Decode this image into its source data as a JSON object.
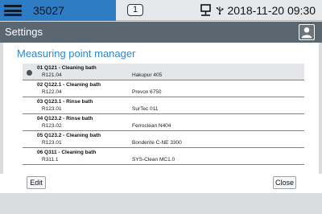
{
  "topbar": {
    "device_id": "35027",
    "badge_count": "1",
    "datetime": "2018-11-20 09:30",
    "icons": [
      "hamburger-icon",
      "network-icon",
      "usb-icon"
    ]
  },
  "titlebar": {
    "title": "Settings",
    "icon": "user-icon"
  },
  "section": {
    "title": "Measuring point manager"
  },
  "measuring_points": [
    {
      "title": "01 Q121 - Cleaning bath",
      "id": "R121.04",
      "product": "Hakupur 405",
      "selected": true
    },
    {
      "title": "02 Q122.1 - Cleaning bath",
      "id": "R122.04",
      "product": "Prevox 6750",
      "selected": false
    },
    {
      "title": "03 Q123.1 - Rinse bath",
      "id": "R123.01",
      "product": "SurTec 011",
      "selected": false
    },
    {
      "title": "04 Q123.2 - Rinse bath",
      "id": "R123.02",
      "product": "Ferroclean N404",
      "selected": false
    },
    {
      "title": "05 Q123.2 - Cleaning bath",
      "id": "R123.01",
      "product": "Bonderite C-NE 3300",
      "selected": false
    },
    {
      "title": "06 Q311 - Cleaning bath",
      "id": "R311.1",
      "product": "SYS-Clean MC1.0",
      "selected": false
    }
  ],
  "footer": {
    "edit_label": "Edit",
    "close_label": "Close"
  },
  "colors": {
    "accent": "#2e7cc4",
    "titlebar": "#5a6670",
    "section_title": "#2f88cf"
  }
}
